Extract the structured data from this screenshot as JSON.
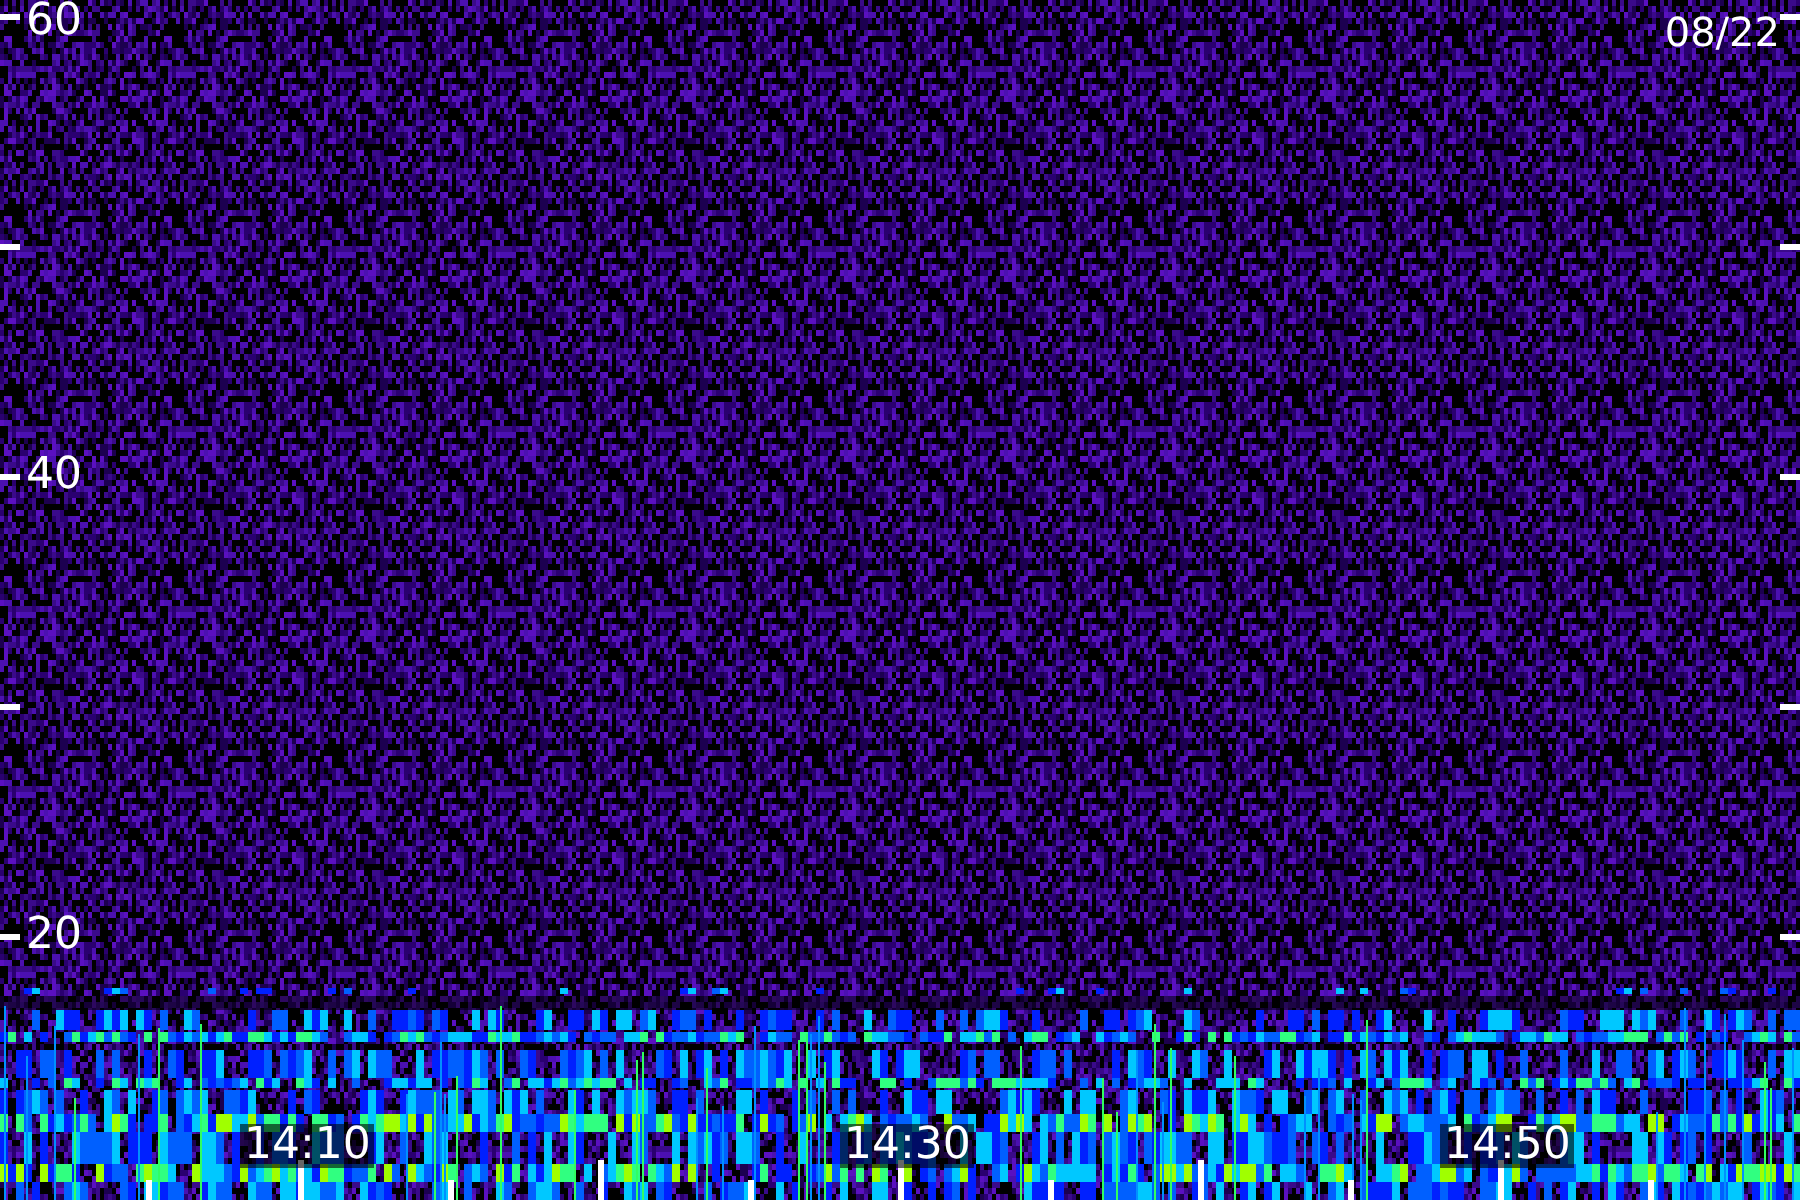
{
  "spectrogram": {
    "date": "08/22",
    "y_labels": [
      "60",
      "40",
      "20"
    ],
    "x_labels": [
      "14:10",
      "14:30",
      "14:50"
    ]
  }
}
